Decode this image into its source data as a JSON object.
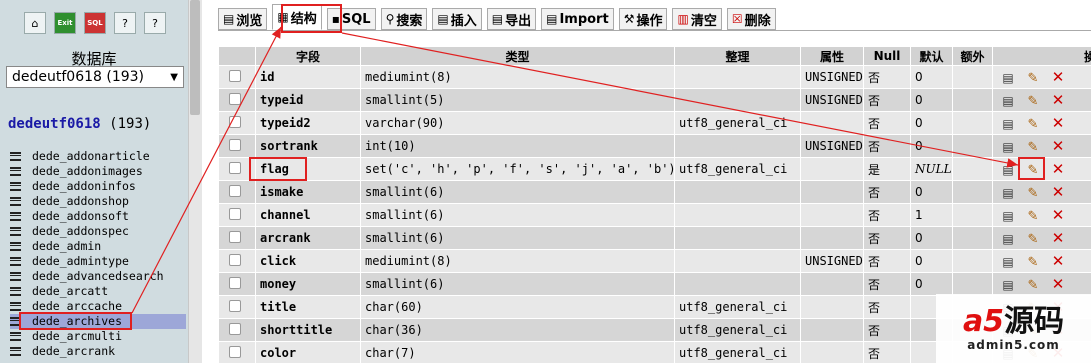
{
  "sidebar": {
    "db_label": "数据库",
    "db_select_value": "dedeutf0618 (193)",
    "db_name": "dedeutf0618",
    "db_count": "(193)",
    "tables": [
      "dede_addonarticle",
      "dede_addonimages",
      "dede_addoninfos",
      "dede_addonshop",
      "dede_addonsoft",
      "dede_addonspec",
      "dede_admin",
      "dede_admintype",
      "dede_advancedsearch",
      "dede_arcatt",
      "dede_arccache",
      "dede_archives",
      "dede_arcmulti",
      "dede_arcrank"
    ],
    "selected_table": "dede_archives",
    "top_icons": [
      "home-icon",
      "exit-icon",
      "sql-icon",
      "help-icon",
      "docs-icon"
    ]
  },
  "tabs": [
    {
      "label": "浏览",
      "icon": "browse-icon"
    },
    {
      "label": "结构",
      "icon": "structure-icon"
    },
    {
      "label": "SQL",
      "icon": "sql-icon"
    },
    {
      "label": "搜索",
      "icon": "search-icon"
    },
    {
      "label": "插入",
      "icon": "insert-icon"
    },
    {
      "label": "导出",
      "icon": "export-icon"
    },
    {
      "label": "Import",
      "icon": "import-icon"
    },
    {
      "label": "操作",
      "icon": "operations-icon"
    },
    {
      "label": "清空",
      "icon": "empty-icon"
    },
    {
      "label": "删除",
      "icon": "drop-icon"
    }
  ],
  "active_tab": "结构",
  "columns": [
    "字段",
    "类型",
    "整理",
    "属性",
    "Null",
    "默认",
    "额外",
    "操"
  ],
  "rows": [
    {
      "field": "id",
      "type": "mediumint(8)",
      "collation": "",
      "attributes": "UNSIGNED",
      "null": "否",
      "default": "0"
    },
    {
      "field": "typeid",
      "type": "smallint(5)",
      "collation": "",
      "attributes": "UNSIGNED",
      "null": "否",
      "default": "0"
    },
    {
      "field": "typeid2",
      "type": "varchar(90)",
      "collation": "utf8_general_ci",
      "attributes": "",
      "null": "否",
      "default": "0"
    },
    {
      "field": "sortrank",
      "type": "int(10)",
      "collation": "",
      "attributes": "UNSIGNED",
      "null": "否",
      "default": "0"
    },
    {
      "field": "flag",
      "type": "set('c', 'h', 'p', 'f', 's', 'j', 'a', 'b')",
      "collation": "utf8_general_ci",
      "attributes": "",
      "null": "是",
      "default": "NULL"
    },
    {
      "field": "ismake",
      "type": "smallint(6)",
      "collation": "",
      "attributes": "",
      "null": "否",
      "default": "0"
    },
    {
      "field": "channel",
      "type": "smallint(6)",
      "collation": "",
      "attributes": "",
      "null": "否",
      "default": "1"
    },
    {
      "field": "arcrank",
      "type": "smallint(6)",
      "collation": "",
      "attributes": "",
      "null": "否",
      "default": "0"
    },
    {
      "field": "click",
      "type": "mediumint(8)",
      "collation": "",
      "attributes": "UNSIGNED",
      "null": "否",
      "default": "0"
    },
    {
      "field": "money",
      "type": "smallint(6)",
      "collation": "",
      "attributes": "",
      "null": "否",
      "default": "0"
    },
    {
      "field": "title",
      "type": "char(60)",
      "collation": "utf8_general_ci",
      "attributes": "",
      "null": "否",
      "default": ""
    },
    {
      "field": "shorttitle",
      "type": "char(36)",
      "collation": "utf8_general_ci",
      "attributes": "",
      "null": "否",
      "default": ""
    },
    {
      "field": "color",
      "type": "char(7)",
      "collation": "utf8_general_ci",
      "attributes": "",
      "null": "否",
      "default": ""
    }
  ],
  "watermark": {
    "brand": "a5源码",
    "site": "admin5.com"
  },
  "colors": {
    "highlight": "#e02020",
    "selected_row": "#9da7d8",
    "sidebar_bg": "#d0dce0"
  }
}
